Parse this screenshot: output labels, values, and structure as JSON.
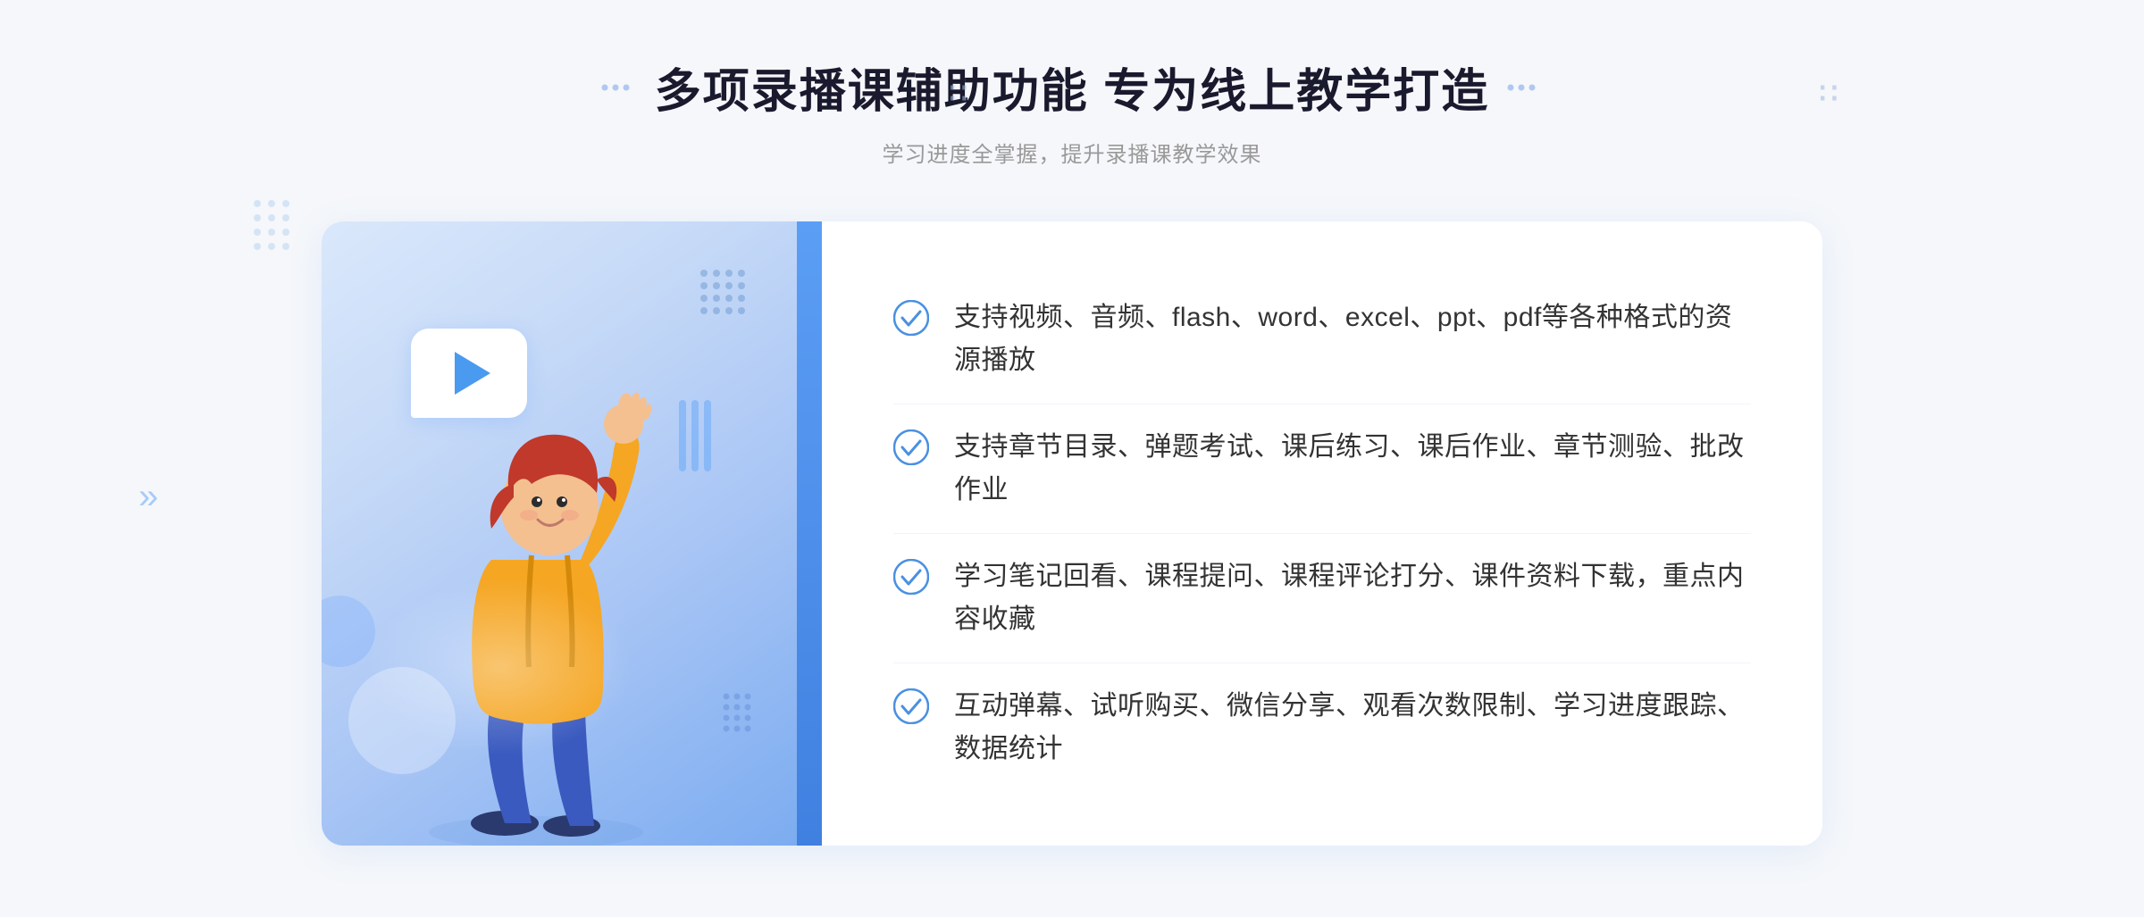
{
  "header": {
    "title": "多项录播课辅助功能 专为线上教学打造",
    "subtitle": "学习进度全掌握，提升录播课教学效果"
  },
  "features": [
    {
      "id": "feature-1",
      "text": "支持视频、音频、flash、word、excel、ppt、pdf等各种格式的资源播放"
    },
    {
      "id": "feature-2",
      "text": "支持章节目录、弹题考试、课后练习、课后作业、章节测验、批改作业"
    },
    {
      "id": "feature-3",
      "text": "学习笔记回看、课程提问、课程评论打分、课件资料下载，重点内容收藏"
    },
    {
      "id": "feature-4",
      "text": "互动弹幕、试听购买、微信分享、观看次数限制、学习进度跟踪、数据统计"
    }
  ],
  "decoration": {
    "chevron": "»",
    "check_symbol": "✓"
  },
  "colors": {
    "primary": "#4a90e2",
    "light_blue": "#c5d9f7",
    "accent": "#5b9ef5",
    "text_dark": "#1a1a2e",
    "text_gray": "#999"
  }
}
